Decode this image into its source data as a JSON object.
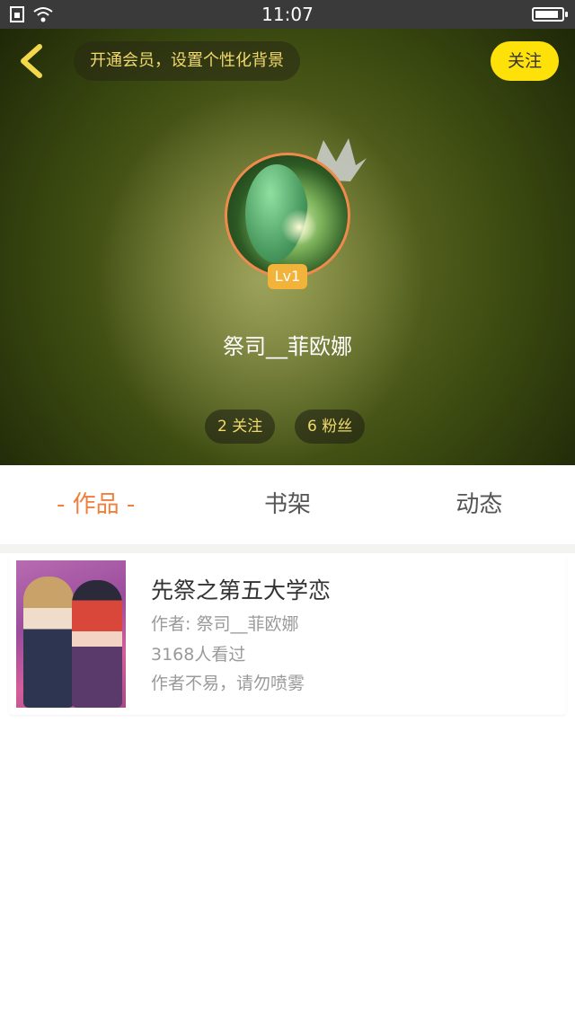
{
  "status_bar": {
    "time": "11:07",
    "battery_percent": 90
  },
  "header": {
    "back_icon": "chevron-left-icon",
    "vip_banner": "开通会员，设置个性化背景",
    "follow_label": "关注",
    "level": "Lv1",
    "username": "祭司__菲欧娜",
    "following": "2 关注",
    "fans": "6 粉丝",
    "accent": "#ffe10a"
  },
  "tabs": [
    {
      "label": "- 作品 -",
      "active": true
    },
    {
      "label": "书架",
      "active": false
    },
    {
      "label": "动态",
      "active": false
    }
  ],
  "works": [
    {
      "title": "先祭之第五大学恋",
      "author": "作者: 祭司__菲欧娜",
      "views": "3168人看过",
      "description": "作者不易，请勿喷雾"
    }
  ]
}
